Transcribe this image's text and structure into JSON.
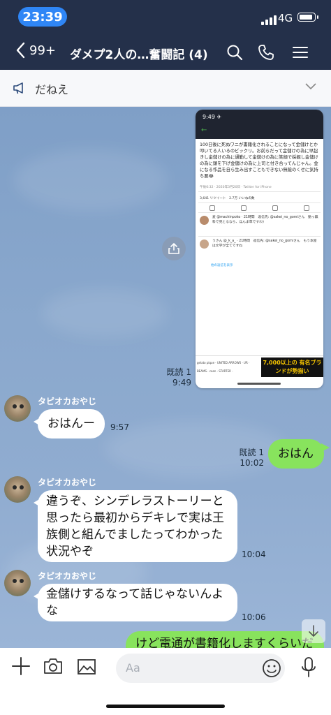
{
  "status": {
    "time": "23:39",
    "network": "4G"
  },
  "nav": {
    "back_count": "99+",
    "title": "ダメプ2人の…奮闘記 (4)"
  },
  "announcement": {
    "text": "だねえ"
  },
  "screenshot": {
    "time": "9:49 ✈",
    "tweet": "100日後に死ぬワニが書籍化されることになって金儲けとか叩いてる人いるのビックリ。お前らだって金儲けの為に早起きし金儲けの為に通勤して金儲けの為に笑顔で採掘し金儲けの為に頭を下げ金儲けの為に上司と付き合ってんじゃん。金になる作品を自ら生み出すこともできない無能のくせに気持ち悪😂",
    "meta": "午後6:32 · 2020年3月20日 · Twitter for iPhone",
    "stats": "3,641 リツイート　2.7万 いいねの数",
    "reply1": "麦 @machinpoko · 21時間　返信先: @sakei_no_gomiさん　動っ無料で見とるなら、ほんま草ですわ)",
    "reply2": "うさん @_k_a_ · 21時間　返信先: @sakei_no_gomiさん　もう本屋は文学が全てですね",
    "more": "他の返信を表示",
    "logos": "gelato pique · UNITED ARROWS · UR · BEAMS · coen · STARTER ·",
    "promo": "7,000以上の 有名ブランドが勢揃い"
  },
  "messages": [
    {
      "side": "right",
      "type": "image",
      "read": "既読 1",
      "time": "9:49"
    },
    {
      "side": "left",
      "sender": "タピオカおやじ",
      "text": "おはんー",
      "time": "9:57"
    },
    {
      "side": "right",
      "read": "既読 1",
      "text": "おはん",
      "time": "10:02"
    },
    {
      "side": "left",
      "sender": "タピオカおやじ",
      "lines": [
        "違うぞ、シンデレラストーリーと",
        "思ったら最初からデキレで実は王",
        "族側と組んでましたってわかった",
        "状況やぞ"
      ],
      "time": "10:04"
    },
    {
      "side": "left",
      "sender": "タピオカおやじ",
      "lines": [
        "金儲けするなって話じゃないんよ",
        "な"
      ],
      "time": "10:06"
    },
    {
      "side": "right",
      "text": "けど電通が書籍化しますくらいだ"
    }
  ],
  "input": {
    "placeholder": "Aa"
  },
  "colors": {
    "header": "#24304a",
    "my_bubble": "#88e35d",
    "time_pill": "#2f86f6"
  }
}
